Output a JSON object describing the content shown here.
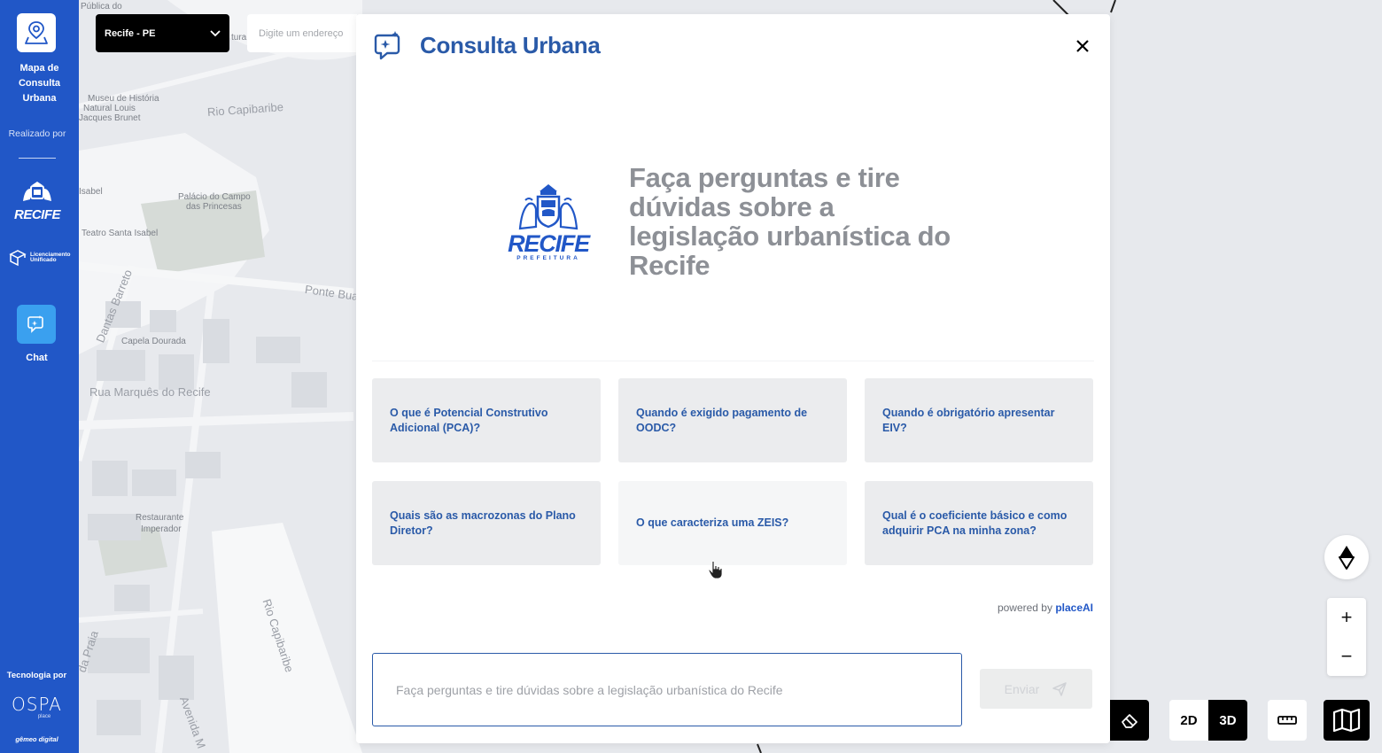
{
  "sidebar": {
    "app_title_line1": "Mapa de",
    "app_title_line2": "Consulta",
    "app_title_line3": "Urbana",
    "realizado_por": "Realizado por",
    "recife_logo_text": "RECIFE",
    "licenciamento_line1": "Licenciamento",
    "licenciamento_line2": "Unificado",
    "chat_label": "Chat",
    "tecnologia_por": "Tecnologia por",
    "ospa_text": "OSPA",
    "ospa_sub": "place",
    "gemeo": "gêmeo digital"
  },
  "topbar": {
    "city": "Recife - PE",
    "address_placeholder": "Digite um endereço"
  },
  "map_labels": {
    "publica": "Pública do",
    "museu1": "Museu de História",
    "museu2": "Natural Louis",
    "museu3": "Jacques Brunet",
    "rio_capibaribe_top": "Rio Capibaribe",
    "isabel": "Isabel",
    "palacio1": "Palácio do Campo",
    "palacio2": "das Princesas",
    "teatro": "Teatro Santa Isabel",
    "ponte": "Ponte Bua",
    "dantas": "Dantas Barreto",
    "capela": "Capela Dourada",
    "rua_marques": "Rua Marquês do Recife",
    "restaurante1": "Restaurante",
    "restaurante2": "Imperador",
    "rio_capibaribe_bottom": "Rio Capibaribe",
    "praia": "da Praia",
    "avenida": "Avenida M",
    "tura": "tura"
  },
  "modal": {
    "title": "Consulta Urbana",
    "hero_line1": "Faça perguntas e tire",
    "hero_line2": "dúvidas sobre a",
    "hero_line3": "legislação urbanística do",
    "hero_line4": "Recife",
    "logo_recife": "RECIFE",
    "logo_prefeitura": "PREFEITURA",
    "suggestions": [
      "O que é Potencial Construtivo Adicional (PCA)?",
      "Quando é exigido pagamento de OODC?",
      "Quando é obrigatório apresentar EIV?",
      "Quais são as macrozonas do Plano Diretor?",
      "O que caracteriza uma ZEIS?",
      "Qual é o coeficiente básico e como adquirir PCA na minha zona?"
    ],
    "powered_prefix": "powered by ",
    "powered_brand": "placeAI",
    "input_placeholder": "Faça perguntas e tire dúvidas sobre a legislação urbanística do Recife",
    "send_label": "Enviar"
  },
  "controls": {
    "zoom_in": "+",
    "zoom_out": "−",
    "view_2d": "2D",
    "view_3d": "3D"
  },
  "colors": {
    "sidebar_bg": "#2157c7",
    "accent_blue": "#2a5aa8",
    "chat_button": "#3aa0ef"
  }
}
